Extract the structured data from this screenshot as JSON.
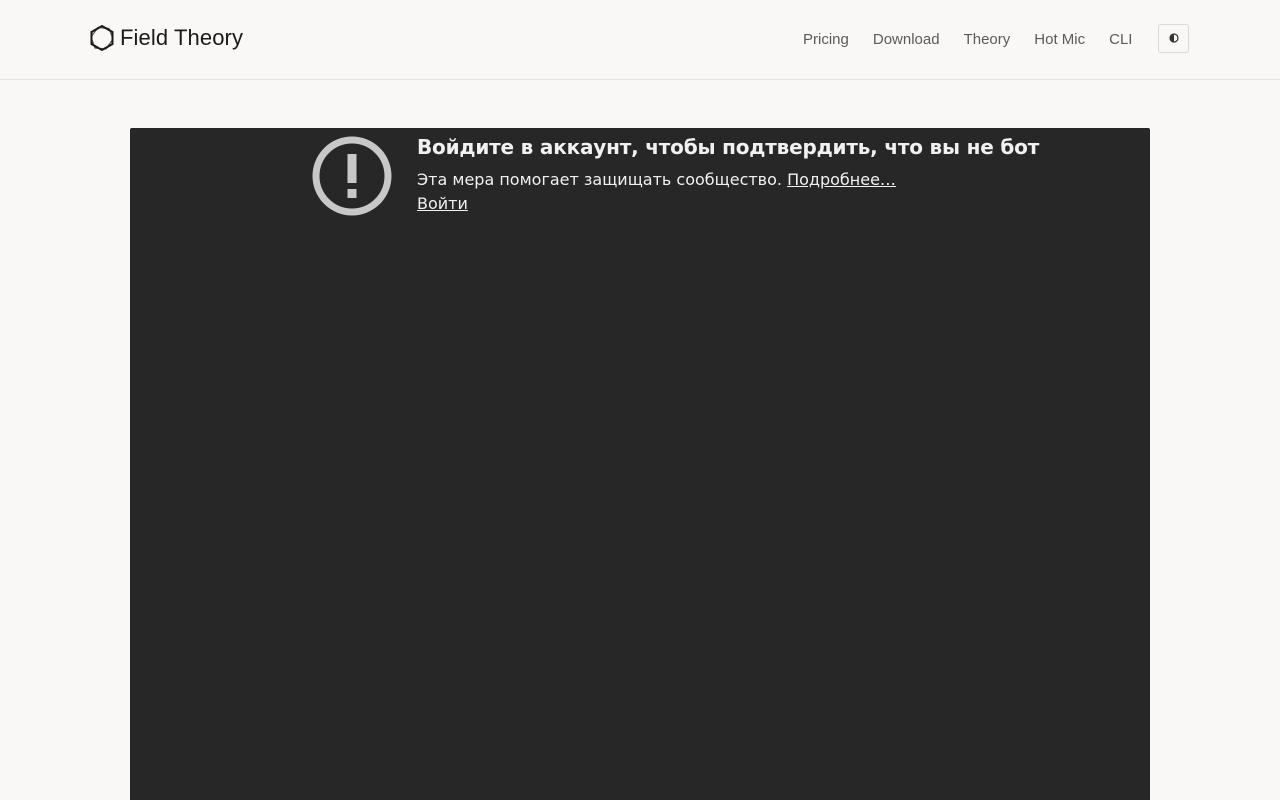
{
  "header": {
    "brand_name": "Field Theory",
    "logo_icon": "hexagon-logo-icon",
    "nav": [
      {
        "label": "Pricing"
      },
      {
        "label": "Download"
      },
      {
        "label": "Theory"
      },
      {
        "label": "Hot Mic"
      },
      {
        "label": "CLI"
      }
    ],
    "theme_toggle_icon": "half-circle-contrast-icon"
  },
  "embed": {
    "background": "#272727",
    "alert_icon": "exclamation-circle-icon",
    "title": "Войдите в аккаунт, чтобы подтвердить, что вы не бот",
    "description": "Эта мера помогает защищать сообщество.",
    "learn_more": "Подробнее…",
    "signin": "Войти"
  },
  "colors": {
    "page_bg": "#f9f8f6",
    "embed_bg": "#272727",
    "text_light": "#f1f1f1",
    "icon_gray": "#c8c8c8"
  }
}
